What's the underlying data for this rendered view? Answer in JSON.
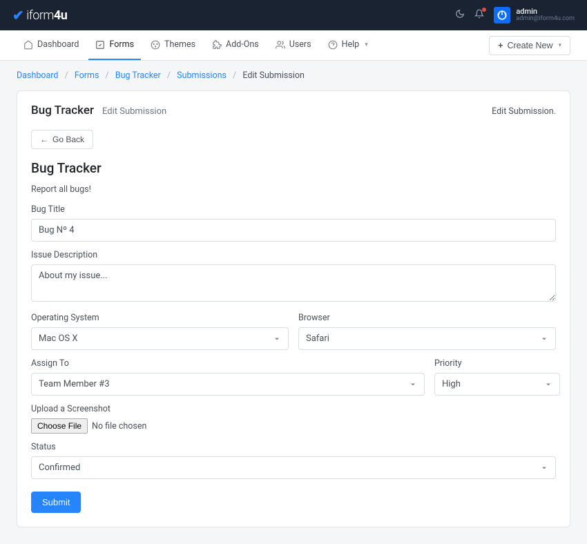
{
  "brand": {
    "name": "iform4u"
  },
  "topbar": {
    "user": {
      "name": "admin",
      "email": "admin@iform4u.com"
    }
  },
  "nav": {
    "items": [
      {
        "label": "Dashboard",
        "icon": "home"
      },
      {
        "label": "Forms",
        "icon": "form",
        "active": true
      },
      {
        "label": "Themes",
        "icon": "palette"
      },
      {
        "label": "Add-Ons",
        "icon": "puzzle"
      },
      {
        "label": "Users",
        "icon": "users"
      },
      {
        "label": "Help",
        "icon": "help",
        "caret": true
      }
    ],
    "create_label": "Create New"
  },
  "breadcrumb": {
    "items": [
      "Dashboard",
      "Forms",
      "Bug Tracker",
      "Submissions"
    ],
    "current": "Edit Submission"
  },
  "card": {
    "title": "Bug Tracker",
    "subtitle": "Edit Submission",
    "action": "Edit Submission.",
    "goback": "Go Back"
  },
  "form": {
    "title": "Bug Tracker",
    "description": "Report all bugs!",
    "fields": {
      "bug_title": {
        "label": "Bug Title",
        "value": "Bug Nº 4"
      },
      "issue_description": {
        "label": "Issue Description",
        "value": "About my issue..."
      },
      "operating_system": {
        "label": "Operating System",
        "value": "Mac OS X"
      },
      "browser": {
        "label": "Browser",
        "value": "Safari"
      },
      "assign_to": {
        "label": "Assign To",
        "value": "Team Member #3"
      },
      "priority": {
        "label": "Priority",
        "value": "High"
      },
      "screenshot": {
        "label": "Upload a Screenshot",
        "button": "Choose File",
        "status": "No file chosen"
      },
      "status": {
        "label": "Status",
        "value": "Confirmed"
      }
    },
    "submit_label": "Submit"
  }
}
